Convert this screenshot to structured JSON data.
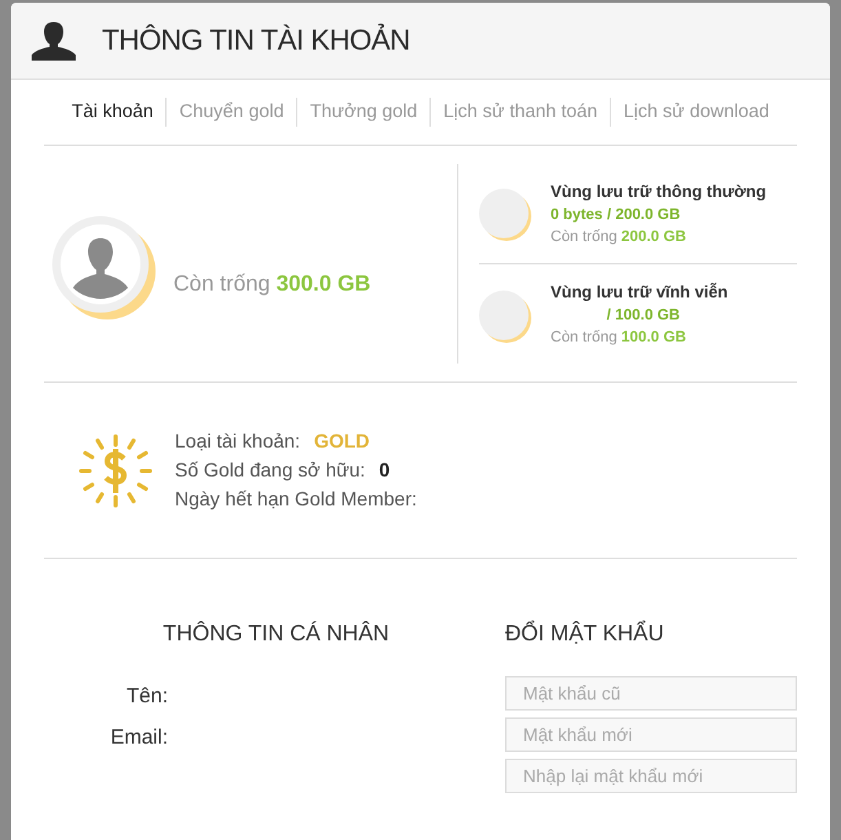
{
  "window": {
    "title": "THÔNG TIN TÀI KHOẢN"
  },
  "tabs": [
    {
      "label": "Tài khoản",
      "selected": true
    },
    {
      "label": "Chuyển gold",
      "selected": false
    },
    {
      "label": "Thưởng gold",
      "selected": false
    },
    {
      "label": "Lịch sử thanh toán",
      "selected": false
    },
    {
      "label": "Lịch sử download",
      "selected": false
    }
  ],
  "storage": {
    "free_label": "Còn trống",
    "free_value": "300.0 GB",
    "areas": [
      {
        "title": "Vùng lưu trữ thông thường",
        "usage": "0 bytes / 200.0 GB",
        "free_label": "Còn trống",
        "free_value": "200.0 GB"
      },
      {
        "title": "Vùng lưu trữ vĩnh viễn",
        "usage": "/ 100.0 GB",
        "free_label": "Còn trống",
        "free_value": "100.0 GB"
      }
    ]
  },
  "account": [
    {
      "label": "Loại tài khoản:",
      "value": "GOLD",
      "kind": "gold"
    },
    {
      "label": "Số Gold đang sở hữu:",
      "value": "0",
      "kind": "plain"
    },
    {
      "label": "Ngày hết hạn Gold Member:"
    }
  ],
  "personal": {
    "title": "THÔNG TIN CÁ NHÂN",
    "fields": [
      {
        "label": "Tên:"
      },
      {
        "label": "Email:"
      }
    ]
  },
  "password": {
    "title": "ĐỔI MẬT KHẨU",
    "fields": [
      {
        "placeholder": "Mật khẩu cũ"
      },
      {
        "placeholder": "Mật khẩu mới"
      },
      {
        "placeholder": "Nhập lại mật khẩu mới"
      }
    ]
  }
}
